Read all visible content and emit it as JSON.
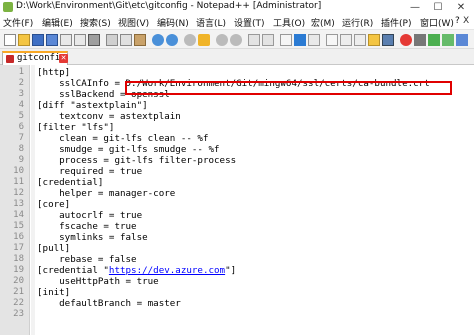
{
  "window": {
    "title": "D:\\Work\\Environment\\Git\\etc\\gitconfig - Notepad++ [Administrator]",
    "minimize": "—",
    "maximize": "☐",
    "close": "✕"
  },
  "menu": {
    "items": [
      "文件(F)",
      "编辑(E)",
      "搜索(S)",
      "视图(V)",
      "编码(N)",
      "语言(L)",
      "设置(T)",
      "工具(O)",
      "宏(M)",
      "运行(R)",
      "插件(P)",
      "窗口(W)",
      "?"
    ],
    "close_glyph": "X"
  },
  "toolbar": {
    "icons": [
      "new-icon",
      "open-icon",
      "save-icon",
      "save-all-icon",
      "close-icon",
      "close-all-icon",
      "print-icon",
      "cut-icon",
      "copy-icon",
      "paste-icon",
      "undo-icon",
      "redo-icon",
      "find-icon",
      "replace-icon",
      "zoom-in-icon",
      "zoom-out-icon",
      "sync-v-icon",
      "sync-h-icon",
      "wrap-icon",
      "all-chars-icon",
      "indent-guide-icon",
      "lang-icon",
      "doc-map-icon",
      "func-list-icon",
      "folder-icon",
      "monitor-icon",
      "record-icon",
      "stop-icon",
      "play-icon",
      "play-multi-icon",
      "save-macro-icon"
    ]
  },
  "tab": {
    "label": "gitconfig",
    "close": "✕"
  },
  "editor": {
    "lines": [
      {
        "n": "1",
        "text": "[http]"
      },
      {
        "n": "2",
        "text": "    sslCAInfo = D:/Work/Environment/Git/mingw64/ssl/certs/ca-bundle.crt"
      },
      {
        "n": "3",
        "text": "    sslBackend = openssl"
      },
      {
        "n": "4",
        "text": "[diff \"astextplain\"]"
      },
      {
        "n": "5",
        "text": "    textconv = astextplain"
      },
      {
        "n": "6",
        "text": "[filter \"lfs\"]"
      },
      {
        "n": "7",
        "text": "    clean = git-lfs clean -- %f"
      },
      {
        "n": "8",
        "text": "    smudge = git-lfs smudge -- %f"
      },
      {
        "n": "9",
        "text": "    process = git-lfs filter-process"
      },
      {
        "n": "10",
        "text": "    required = true"
      },
      {
        "n": "11",
        "text": "[credential]"
      },
      {
        "n": "12",
        "text": "    helper = manager-core"
      },
      {
        "n": "13",
        "text": "[core]"
      },
      {
        "n": "14",
        "text": "    autocrlf = true"
      },
      {
        "n": "15",
        "text": "    fscache = true"
      },
      {
        "n": "16",
        "text": "    symlinks = false"
      },
      {
        "n": "17",
        "text": "[pull]"
      },
      {
        "n": "18",
        "text": "    rebase = false"
      },
      {
        "n": "19",
        "text": "[credential \"",
        "url": "https://dev.azure.com",
        "after": "\"]"
      },
      {
        "n": "20",
        "text": "    useHttpPath = true"
      },
      {
        "n": "21",
        "text": "[init]"
      },
      {
        "n": "22",
        "text": "    defaultBranch = master"
      },
      {
        "n": "23",
        "text": ""
      }
    ]
  },
  "colors": {
    "highlight_border": "#e00000",
    "tab_accent": "#f9a825",
    "url": "#0000ff"
  }
}
